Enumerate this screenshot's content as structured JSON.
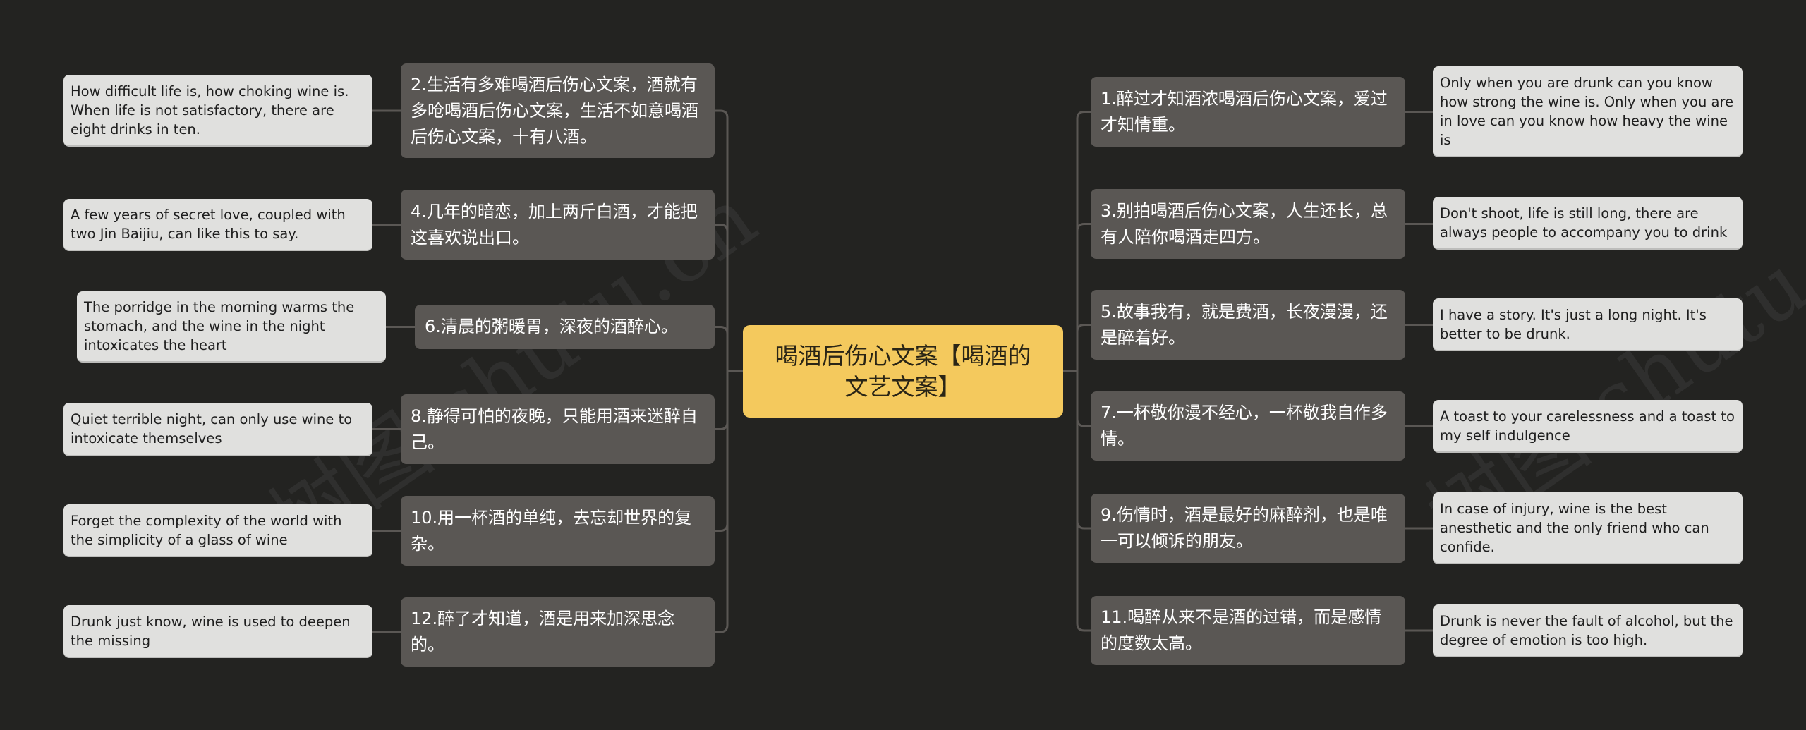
{
  "title": "喝酒后伤心文案【喝酒的文艺文案】",
  "watermark": "树图 shutu.cn",
  "colors": {
    "background": "#232321",
    "center": "#f4c95d",
    "zh_node": "#5a5754",
    "en_node": "#e0e0de",
    "connector": "#5a5754"
  },
  "left": [
    {
      "zh": "2.生活有多难喝酒后伤心文案，酒就有多呛喝酒后伤心文案，生活不如意喝酒后伤心文案，十有八酒。",
      "en": "How difficult life is, how choking wine is. When life is not satisfactory, there are eight drinks in ten."
    },
    {
      "zh": "4.几年的暗恋，加上两斤白酒，才能把这喜欢说出口。",
      "en": "A few years of secret love, coupled with two Jin Baijiu, can like this to say."
    },
    {
      "zh": "6.清晨的粥暖胃，深夜的酒醉心。",
      "en": "The porridge in the morning warms the stomach, and the wine in the night intoxicates the heart"
    },
    {
      "zh": "8.静得可怕的夜晚，只能用酒来迷醉自己。",
      "en": "Quiet terrible night, can only use wine to intoxicate themselves"
    },
    {
      "zh": "10.用一杯酒的单纯，去忘却世界的复杂。",
      "en": "Forget the complexity of the world with the simplicity of a glass of wine"
    },
    {
      "zh": "12.醉了才知道，酒是用来加深思念的。",
      "en": "Drunk just know, wine is used to deepen the missing"
    }
  ],
  "right": [
    {
      "zh": "1.醉过才知酒浓喝酒后伤心文案，爱过才知情重。",
      "en": "Only when you are drunk can you know how strong the wine is. Only when you are  in love can you know how heavy the wine is"
    },
    {
      "zh": "3.别拍喝酒后伤心文案，人生还长，总有人陪你喝酒走四方。",
      "en": "Don't shoot, life is still long, there are always people to accompany you to drink"
    },
    {
      "zh": "5.故事我有，就是费酒，长夜漫漫，还是醉着好。",
      "en": "I have a story. It's just a long night. It's better to be drunk."
    },
    {
      "zh": "7.一杯敬你漫不经心，一杯敬我自作多情。",
      "en": "A toast to your carelessness and a toast to my self indulgence"
    },
    {
      "zh": "9.伤情时，酒是最好的麻醉剂，也是唯一可以倾诉的朋友。",
      "en": "In case of injury, wine is the best anesthetic and the only friend who can confide."
    },
    {
      "zh": "11.喝醉从来不是酒的过错，而是感情的度数太高。",
      "en": "Drunk is never the fault of alcohol, but the  degree of emotion is too high."
    }
  ]
}
